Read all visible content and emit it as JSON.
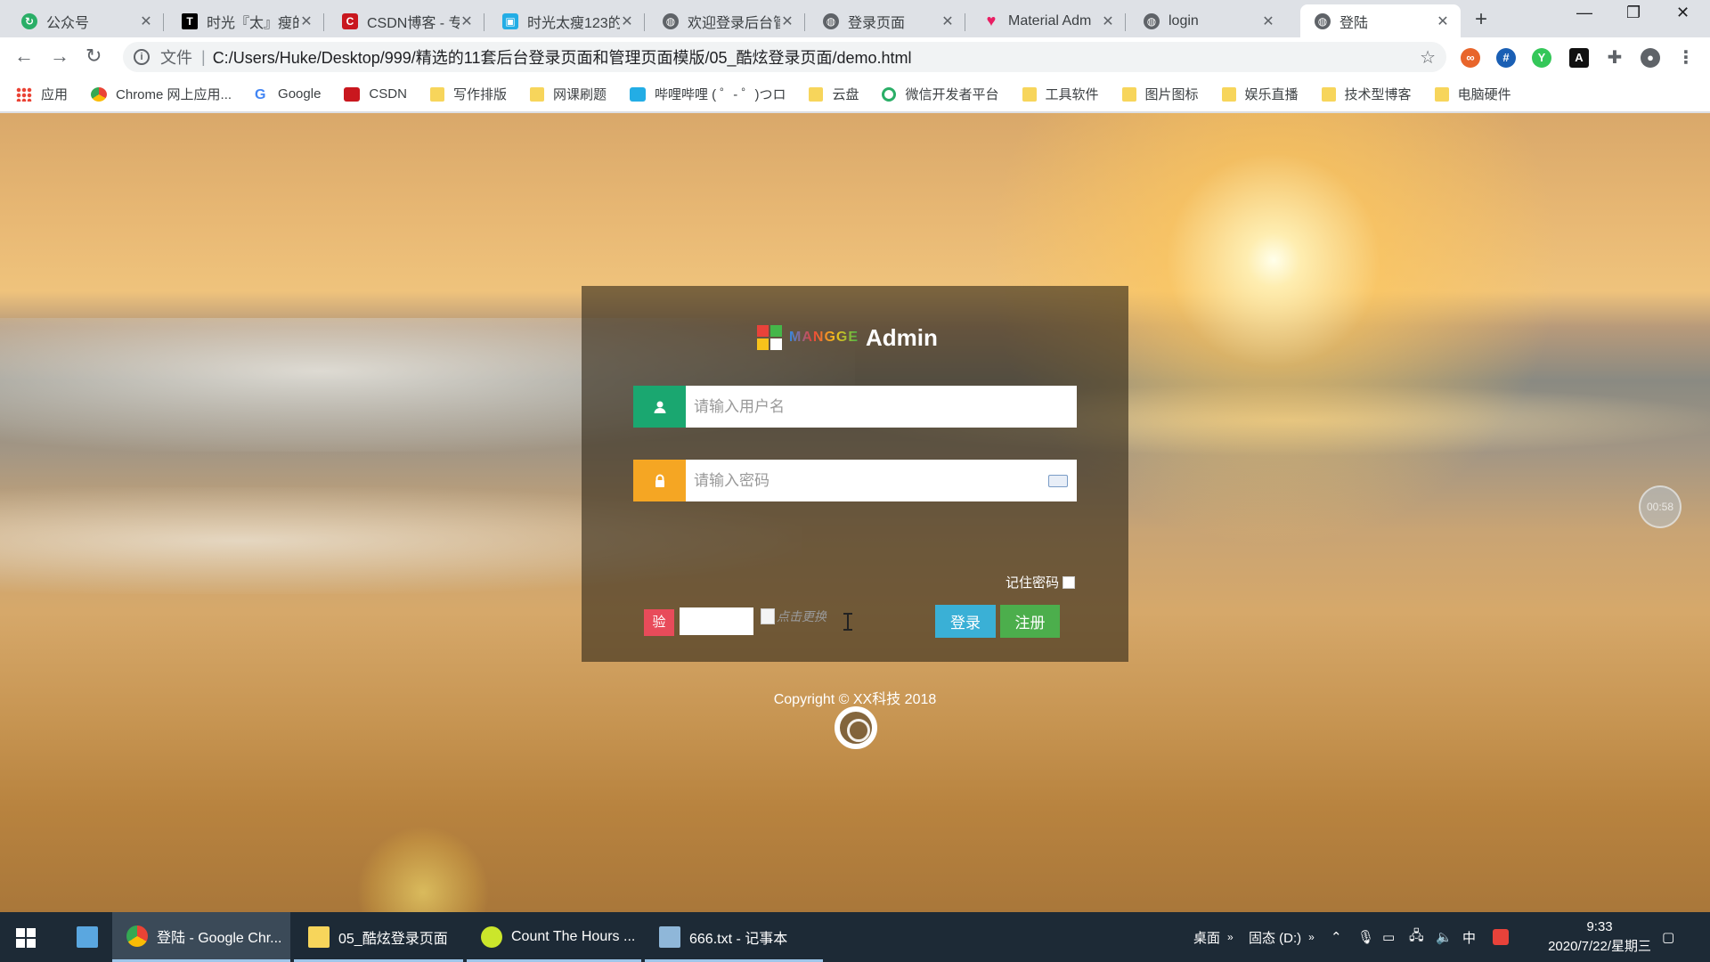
{
  "browser": {
    "tabs": [
      {
        "title": "公众号",
        "icon": "refresh-green-icon",
        "color": "#2aae67"
      },
      {
        "title": "时光『太』瘦的",
        "icon": "tg-icon",
        "color": "#000000"
      },
      {
        "title": "CSDN博客 - 专",
        "icon": "csdn-icon",
        "color": "#c9171e"
      },
      {
        "title": "时光太瘦123的",
        "icon": "bilibili-icon",
        "color": "#23ade5"
      },
      {
        "title": "欢迎登录后台管",
        "icon": "globe-icon",
        "color": "#5f6368"
      },
      {
        "title": "登录页面",
        "icon": "globe-icon",
        "color": "#5f6368"
      },
      {
        "title": "Material Adm",
        "icon": "heart-icon",
        "color": "#e91e63"
      },
      {
        "title": "login",
        "icon": "globe-icon",
        "color": "#5f6368"
      },
      {
        "title": "登陆",
        "icon": "globe-icon",
        "color": "#5f6368",
        "active": true
      }
    ],
    "close_glyph": "✕",
    "new_tab_glyph": "+",
    "window": {
      "minimize": "—",
      "restore": "❐",
      "close": "✕"
    },
    "address": {
      "scheme_label": "文件",
      "url": "C:/Users/Huke/Desktop/999/精选的11套后台登录页面和管理页面模版/05_酷炫登录页面/demo.html"
    },
    "bookmarks": [
      {
        "label": "应用",
        "icon": "apps-grid-icon"
      },
      {
        "label": "Chrome 网上应用...",
        "icon": "chrome-store-icon"
      },
      {
        "label": "Google",
        "icon": "google-icon"
      },
      {
        "label": "CSDN",
        "icon": "csdn-icon"
      },
      {
        "label": "写作排版",
        "icon": "folder-icon"
      },
      {
        "label": "网课刷题",
        "icon": "folder-icon"
      },
      {
        "label": "哔哩哔哩 ( ゜- ゜)つロ",
        "icon": "bilibili-icon"
      },
      {
        "label": "云盘",
        "icon": "folder-icon"
      },
      {
        "label": "微信开发者平台",
        "icon": "wechat-icon"
      },
      {
        "label": "工具软件",
        "icon": "folder-icon"
      },
      {
        "label": "图片图标",
        "icon": "folder-icon"
      },
      {
        "label": "娱乐直播",
        "icon": "folder-icon"
      },
      {
        "label": "技术型博客",
        "icon": "folder-icon"
      },
      {
        "label": "电脑硬件",
        "icon": "folder-icon"
      }
    ]
  },
  "login": {
    "logo": {
      "brand": "MANGGE",
      "suffix": "Admin"
    },
    "username": {
      "placeholder": "请输入用户名",
      "value": ""
    },
    "password": {
      "placeholder": "请输入密码",
      "value": ""
    },
    "remember_label": "记住密码",
    "captcha": {
      "badge": "验",
      "image_alt": "点击更换",
      "value": ""
    },
    "login_button": "登录",
    "register_button": "注册",
    "copyright": "Copyright © XX科技 2018",
    "timer": "00:58",
    "colors": {
      "user_icon_bg": "#1aa770",
      "lock_icon_bg": "#f5a623",
      "login_btn": "#3ab0d6",
      "register_btn": "#4cae4c",
      "captcha_badge": "#e84b5a"
    }
  },
  "taskbar": {
    "items": [
      {
        "label": "登陆 - Google Chr...",
        "icon": "chrome-icon",
        "active": true
      },
      {
        "label": "05_酷炫登录页面",
        "icon": "folder-icon"
      },
      {
        "label": "Count The Hours ...",
        "icon": "app-icon"
      },
      {
        "label": "666.txt - 记事本",
        "icon": "notepad-icon"
      }
    ],
    "tray": {
      "desktop": "桌面",
      "drive": "固态 (D:)",
      "ime": "中",
      "time": "9:33",
      "date": "2020/7/22/星期三"
    }
  }
}
